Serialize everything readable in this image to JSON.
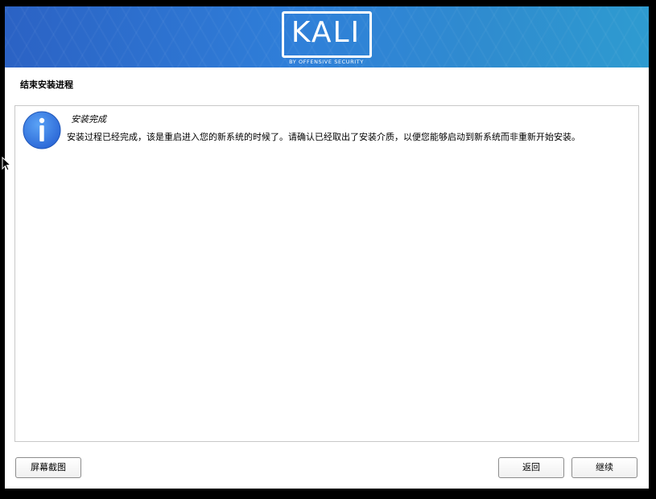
{
  "banner": {
    "logo_text": "KALI",
    "logo_subtitle": "BY OFFENSIVE SECURITY",
    "colors": {
      "left": "#2b62c4",
      "right": "#2e9bd0"
    }
  },
  "page": {
    "title": "结束安装进程"
  },
  "message": {
    "icon": "info-icon",
    "title": "安装完成",
    "body": "安装过程已经完成，该是重启进入您的新系统的时候了。请确认已经取出了安装介质，以便您能够启动到新系统而非重新开始安装。"
  },
  "buttons": {
    "screenshot_label": "屏幕截图",
    "back_label": "返回",
    "continue_label": "继续"
  }
}
